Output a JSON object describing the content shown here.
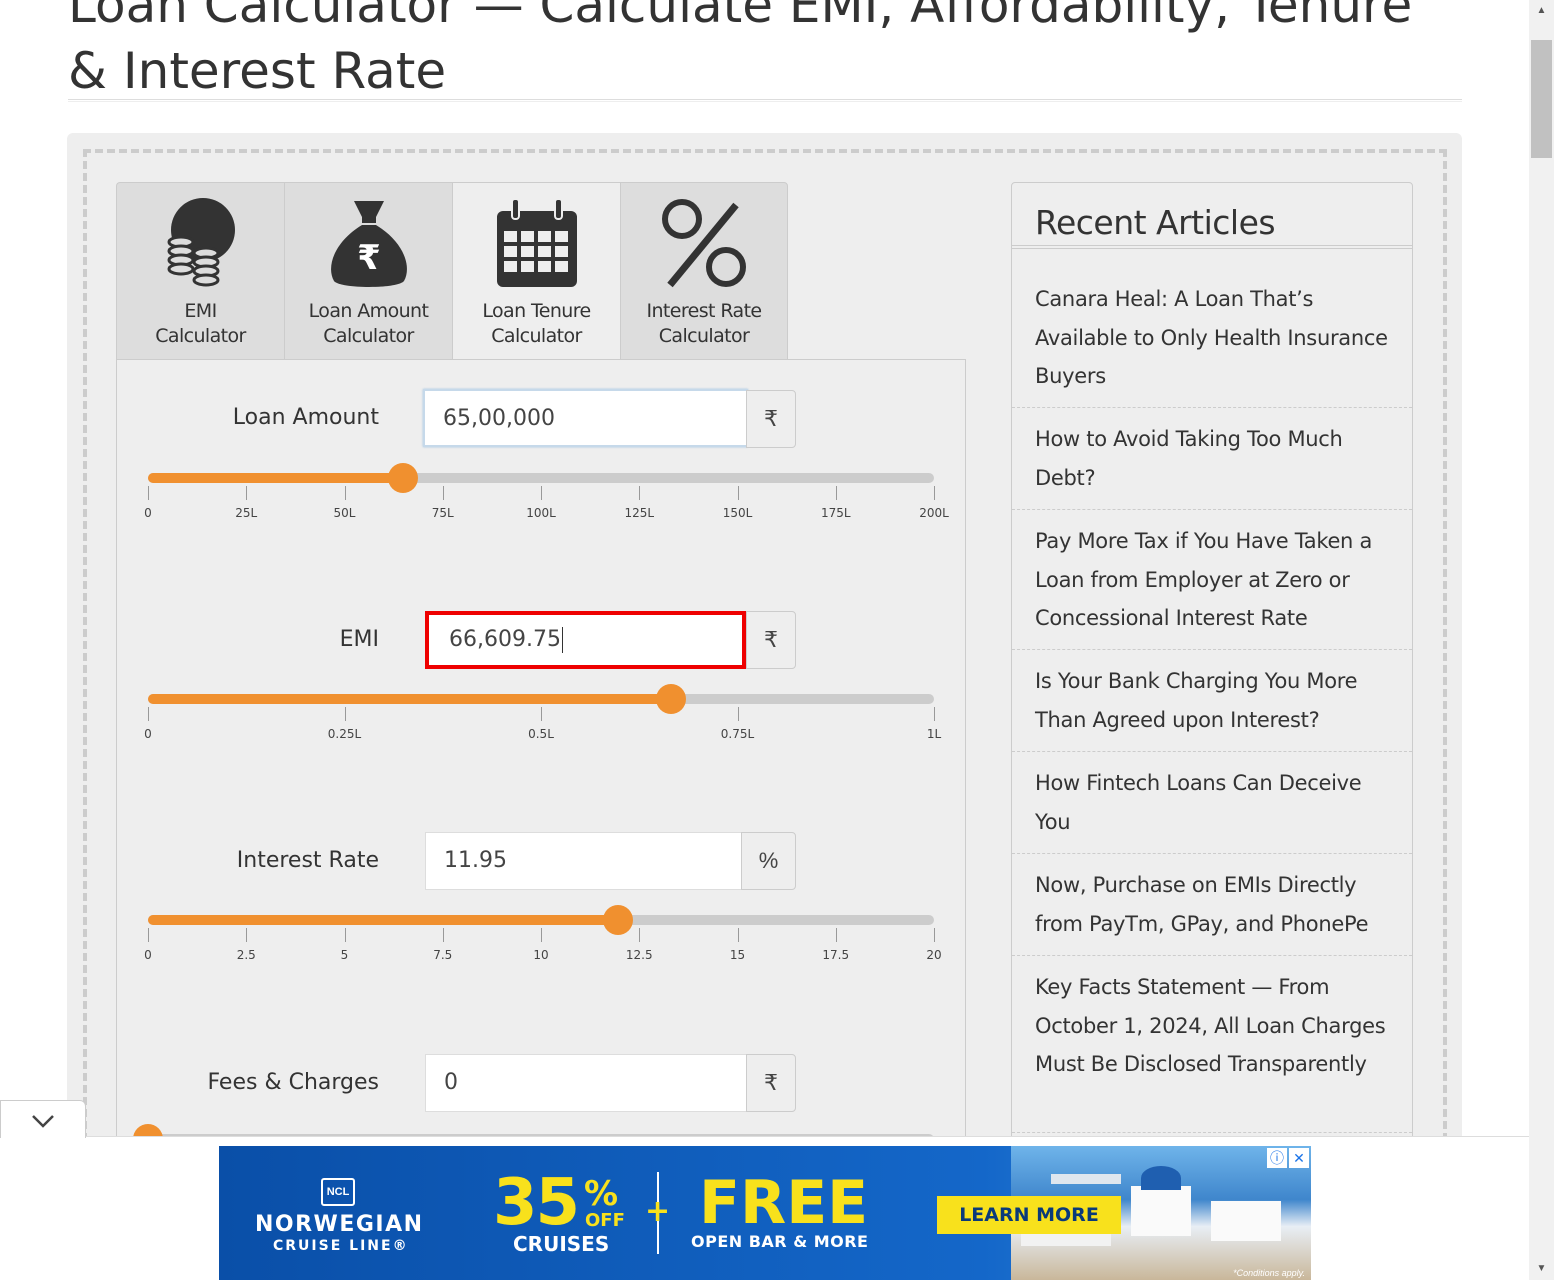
{
  "page": {
    "title": "Loan Calculator — Calculate EMI, Affordability, Tenure & Interest Rate"
  },
  "tabs": [
    {
      "label_line1": "EMI",
      "label_line2": "Calculator",
      "icon": "coins-icon",
      "active": false
    },
    {
      "label_line1": "Loan Amount",
      "label_line2": "Calculator",
      "icon": "money-bag-icon",
      "active": false
    },
    {
      "label_line1": "Loan Tenure",
      "label_line2": "Calculator",
      "icon": "calendar-icon",
      "active": true
    },
    {
      "label_line1": "Interest Rate",
      "label_line2": "Calculator",
      "icon": "percent-icon",
      "active": false
    }
  ],
  "form": {
    "loan_amount": {
      "label": "Loan Amount",
      "value": "65,00,000",
      "unit": "₹",
      "slider_fraction": 0.325,
      "ticks": [
        "0",
        "25L",
        "50L",
        "75L",
        "100L",
        "125L",
        "150L",
        "175L",
        "200L"
      ]
    },
    "emi": {
      "label": "EMI",
      "value": "66,609.75",
      "unit": "₹",
      "slider_fraction": 0.666,
      "ticks": [
        "0",
        "0.25L",
        "0.5L",
        "0.75L",
        "1L"
      ]
    },
    "interest_rate": {
      "label": "Interest Rate",
      "value": "11.95",
      "unit": "%",
      "slider_fraction": 0.5975,
      "ticks": [
        "0",
        "2.5",
        "5",
        "7.5",
        "10",
        "12.5",
        "15",
        "17.5",
        "20"
      ]
    },
    "fees": {
      "label": "Fees & Charges",
      "value": "0",
      "unit": "₹"
    }
  },
  "sidebar": {
    "title": "Recent Articles",
    "articles": [
      "Canara Heal: A Loan That’s Available to Only Health Insurance Buyers",
      "How to Avoid Taking Too Much Debt?",
      "Pay More Tax if You Have Taken a Loan from Employer at Zero or Concessional Interest Rate",
      "Is Your Bank Charging You More Than Agreed upon Interest?",
      "How Fintech Loans Can Deceive You",
      "Now, Purchase on EMIs Directly from PayTm, GPay, and PhonePe",
      "Key Facts Statement — From October 1, 2024, All Loan Charges Must Be Disclosed Transparently"
    ]
  },
  "ad": {
    "logo": "NCL",
    "brand_line1": "NORWEGIAN",
    "brand_line2": "CRUISE LINE",
    "trademark": "®",
    "percent": "35",
    "percent_sign": "%",
    "off": "OFF",
    "cruises": "CRUISES",
    "plus": "+",
    "free": "FREE",
    "open_bar": "OPEN BAR & MORE",
    "cta": "LEARN MORE",
    "fine_print": "*Conditions apply.",
    "colors": {
      "background": "#1467c9",
      "accent": "#f8e11c"
    }
  },
  "colors": {
    "slider": "#f0902f",
    "error_border": "#e00000"
  }
}
